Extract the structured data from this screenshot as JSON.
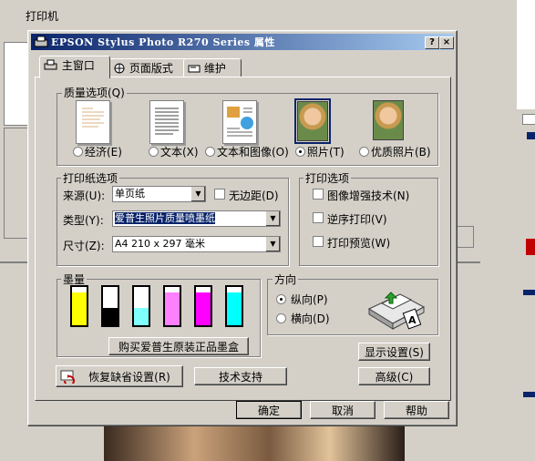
{
  "background_window": {
    "title": "打印机"
  },
  "dialog": {
    "title": "EPSON Stylus Photo R270 Series 属性",
    "help_button": "?",
    "close_button": "×",
    "tabs": [
      {
        "label": "主窗口",
        "icon": "printer-icon",
        "active": true
      },
      {
        "label": "页面版式",
        "icon": "layout-icon",
        "active": false
      },
      {
        "label": "维护",
        "icon": "maintenance-icon",
        "active": false
      }
    ]
  },
  "quality": {
    "title": "质量选项(Q)",
    "options": [
      {
        "label": "经济(E)",
        "selected": false
      },
      {
        "label": "文本(X)",
        "selected": false
      },
      {
        "label": "文本和图像(O)",
        "selected": false
      },
      {
        "label": "照片(T)",
        "selected": true
      },
      {
        "label": "优质照片(B)",
        "selected": false
      }
    ]
  },
  "paper": {
    "title": "打印纸选项",
    "source_label": "来源(U):",
    "source_value": "单页纸",
    "borderless_label": "无边距(D)",
    "borderless_checked": false,
    "type_label": "类型(Y):",
    "type_value": "爱普生照片质量喷墨纸",
    "size_label": "尺寸(Z):",
    "size_value": "A4 210 x 297 毫米"
  },
  "print_options": {
    "title": "打印选项",
    "items": [
      {
        "label": "图像增强技术(N)",
        "checked": false
      },
      {
        "label": "逆序打印(V)",
        "checked": false
      },
      {
        "label": "打印预览(W)",
        "checked": false
      }
    ]
  },
  "ink": {
    "title": "墨量",
    "cartridges": [
      {
        "color": "#ffff00",
        "level": 0.85
      },
      {
        "color": "#000000",
        "level": 0.45
      },
      {
        "color": "#80ffff",
        "level": 0.45
      },
      {
        "color": "#ff80ff",
        "level": 0.85
      },
      {
        "color": "#ff00ff",
        "level": 0.85
      },
      {
        "color": "#00ffff",
        "level": 0.85
      }
    ],
    "buy_button": "购买爱普生原装正品墨盒"
  },
  "orientation": {
    "title": "方向",
    "portrait": "纵向(P)",
    "landscape": "横向(D)",
    "selected": "portrait"
  },
  "buttons": {
    "display_settings": "显示设置(S)",
    "advanced": "高级(C)",
    "restore_defaults": "恢复缺省设置(R)",
    "tech_support": "技术支持",
    "ok": "确定",
    "cancel": "取消",
    "help": "帮助"
  },
  "colors": {
    "titlebar_start": "#0a246a",
    "titlebar_end": "#a6caf0",
    "face": "#d4d0c8"
  }
}
